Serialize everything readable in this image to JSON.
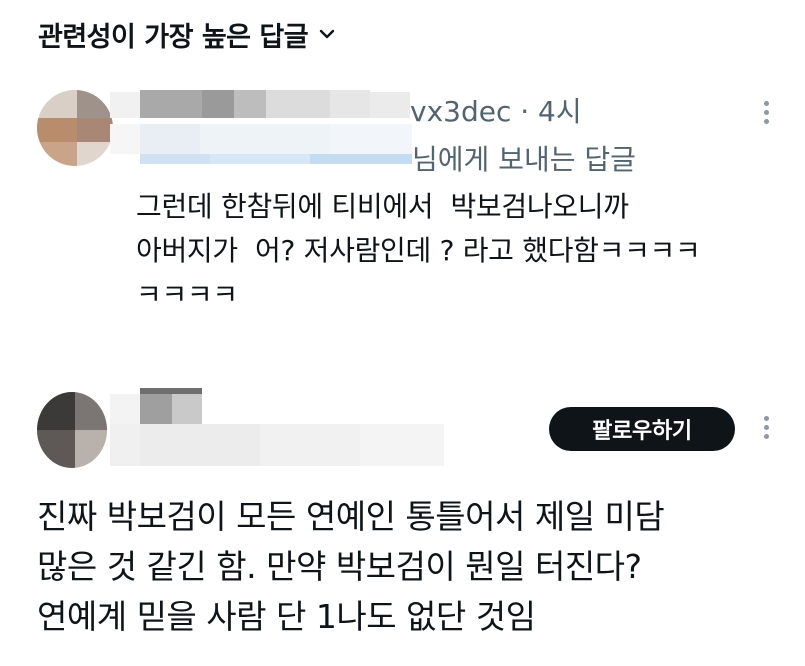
{
  "header": {
    "sort_label": "관련성이 가장 높은 답글",
    "chevron_icon": "chevron-down-icon"
  },
  "replies": [
    {
      "handle_visible": "vx3dec · 4시",
      "replying_to_visible": "님에게 보내는 답글",
      "body": "그런데 한참뒤에 티비에서  박보검나오니까\n아버지가  어? 저사람인데 ? 라고 했다함ㅋㅋㅋㅋ\nㅋㅋㅋㅋ",
      "more_icon": "more-vertical-icon"
    },
    {
      "follow_label": "팔로우하기",
      "body": "진짜 박보검이 모든 연예인 통틀어서 제일 미담\n많은 것 같긴 함. 만약 박보검이 뭔일 터진다?\n연예계 믿을 사람 단 1나도 없단 것임",
      "more_icon": "more-vertical-icon"
    }
  ],
  "colors": {
    "text_primary": "#0f1419",
    "text_secondary": "#536471",
    "follow_button_bg": "#0f1419",
    "follow_button_text": "#ffffff",
    "icon_gray": "#8b98a5"
  }
}
